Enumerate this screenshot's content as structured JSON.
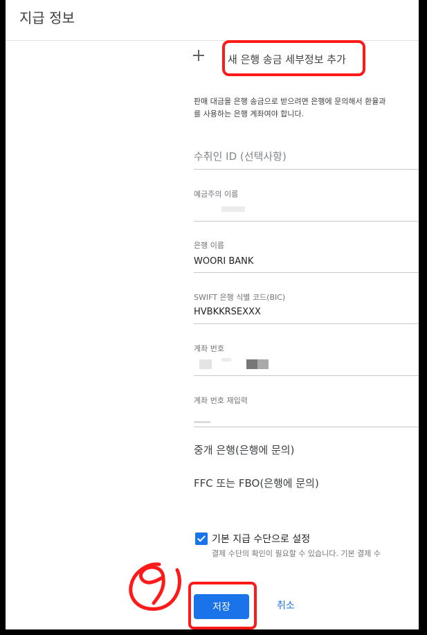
{
  "header": {
    "title": "지급 정보"
  },
  "add_bank": {
    "label": "새 은행 송금 세부정보 추가"
  },
  "notice": {
    "line1": "판매 대금을 은행 송금으로 받으려면 은행에 문의해서 환율과",
    "line2": "를 사용하는 은행 계좌여야 합니다."
  },
  "fields": {
    "recipient_id": {
      "placeholder": "수취인 ID (선택사항)"
    },
    "account_holder": {
      "label": "예금주의 이름"
    },
    "bank_name": {
      "label": "은행 이름",
      "value": "WOORI BANK"
    },
    "swift": {
      "label": "SWIFT 은행 식별 코드(BIC)",
      "value": "HVBKKRSEXXX"
    },
    "account_number": {
      "label": "계좌 번호"
    },
    "account_number_confirm": {
      "label": "계좌 번호 재입력"
    }
  },
  "intermediary_bank": {
    "label": "중개 은행(은행에 문의)"
  },
  "ffc_fbo": {
    "label": "FFC 또는 FBO(은행에 문의)"
  },
  "default_payment": {
    "checked": true,
    "label": "기본 지급 수단으로 설정",
    "sub": "결제 수단의 확인이 필요할 수 있습니다. 기본 결제 수"
  },
  "actions": {
    "save_label": "저장",
    "cancel_label": "취소"
  },
  "colors": {
    "accent": "#1a73e8",
    "annotation": "#ff1a1a"
  }
}
